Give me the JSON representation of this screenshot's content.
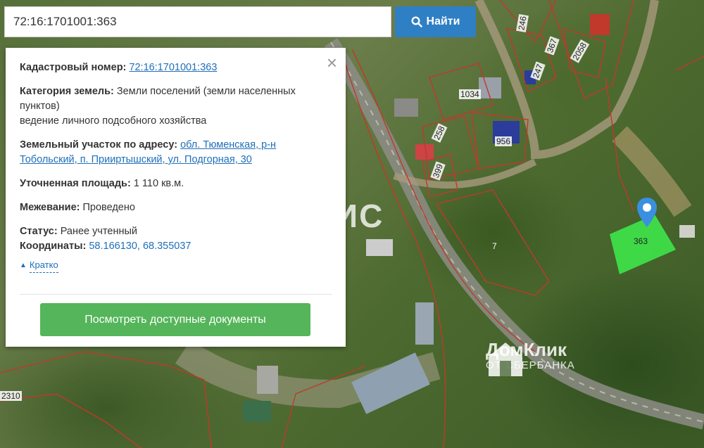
{
  "search": {
    "value": "72:16:1701001:363",
    "button_label": "Найти"
  },
  "popup": {
    "cadastral_label": "Кадастровый номер:",
    "cadastral_value": "72:16:1701001:363",
    "category_label": "Категория земель:",
    "category_value": "Земли поселений (земли населенных пунктов)",
    "category_use": "ведение личного подсобного хозяйства",
    "address_label": "Земельный участок по адресу:",
    "address_value": "обл. Тюменская, р-н Тобольский, п. Прииртышский, ул. Подгорная, 30",
    "area_label": "Уточненная площадь:",
    "area_value": "1 110 кв.м.",
    "survey_label": "Межевание:",
    "survey_value": "Проведено",
    "status_label": "Статус:",
    "status_value": "Ранее учтенный",
    "coords_label": "Координаты:",
    "coords_value": "58.166130, 68.355037",
    "short_label": "Кратко",
    "docs_button": "Посмотреть доступные документы"
  },
  "map_labels": {
    "p246": "246",
    "p367": "367",
    "p2058": "2058",
    "p247": "247",
    "p1034": "1034",
    "p258": "258",
    "p956": "956",
    "p399": "399",
    "p7": "7",
    "p363": "363",
    "p2310": "2310"
  },
  "watermarks": {
    "vladis": "ВЛАДИС",
    "domclick": "ДомКлик",
    "domclick_sub": "ОТ СБЕРБАНКА"
  },
  "colors": {
    "search_button": "#2f7fc5",
    "docs_button": "#55b55a",
    "link": "#1f6fb8",
    "parcel_highlight": "#3ee64a",
    "marker": "#3a8fe0",
    "boundary": "#c0392b"
  }
}
